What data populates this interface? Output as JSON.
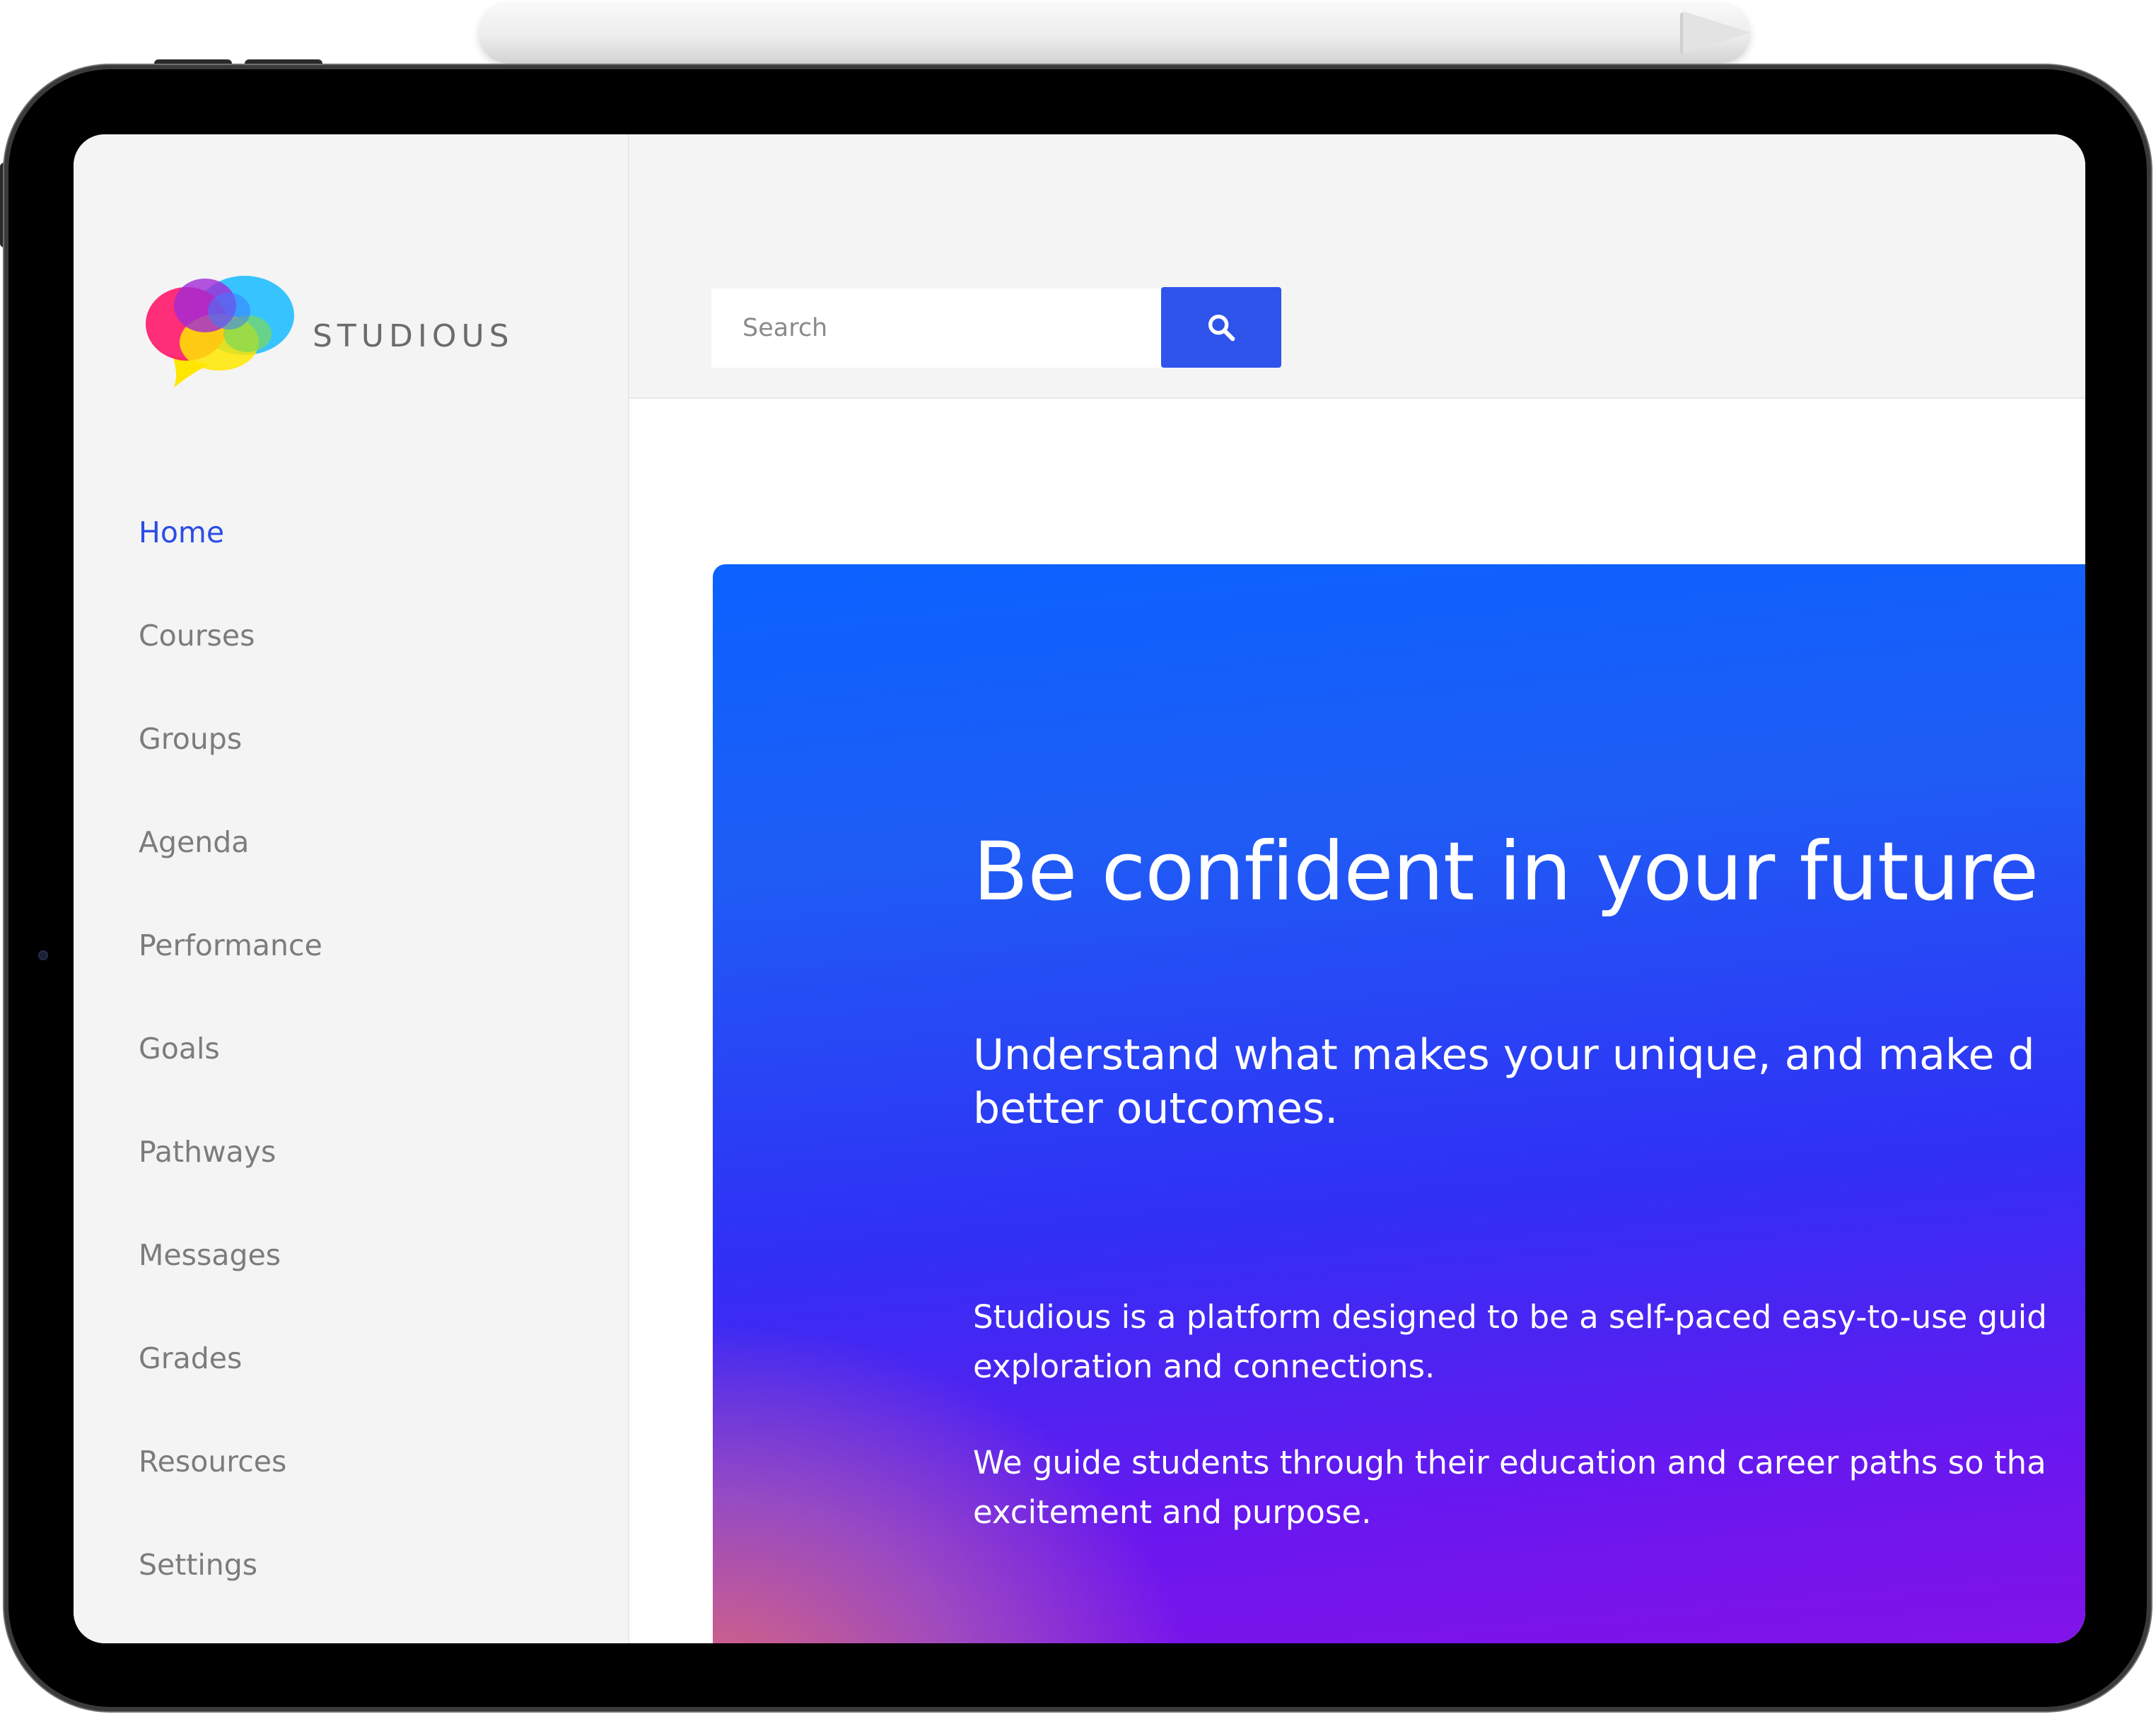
{
  "app": {
    "brand_name": "STUDIOUS",
    "accent_color": "#2b4de5",
    "search_button_color": "#2f54eb"
  },
  "sidebar": {
    "items": [
      {
        "label": "Home",
        "active": true
      },
      {
        "label": "Courses",
        "active": false
      },
      {
        "label": "Groups",
        "active": false
      },
      {
        "label": "Agenda",
        "active": false
      },
      {
        "label": "Performance",
        "active": false
      },
      {
        "label": "Goals",
        "active": false
      },
      {
        "label": "Pathways",
        "active": false
      },
      {
        "label": "Messages",
        "active": false
      },
      {
        "label": "Grades",
        "active": false
      },
      {
        "label": "Resources",
        "active": false
      },
      {
        "label": "Settings",
        "active": false
      }
    ]
  },
  "search": {
    "placeholder": "Search",
    "value": "",
    "button_icon": "search-icon"
  },
  "hero": {
    "title": "Be confident in your future",
    "subtitle": "Understand what makes your unique, and make d better outcomes.",
    "paragraph_1": "Studious is a platform designed to be a self-paced easy-to-use guid exploration and connections.",
    "paragraph_2": "We guide students through their education and career paths so tha excitement and purpose.",
    "gradient_colors": [
      "#0b62ff",
      "#3030f5",
      "#8a12e6",
      "#de6a76"
    ]
  }
}
